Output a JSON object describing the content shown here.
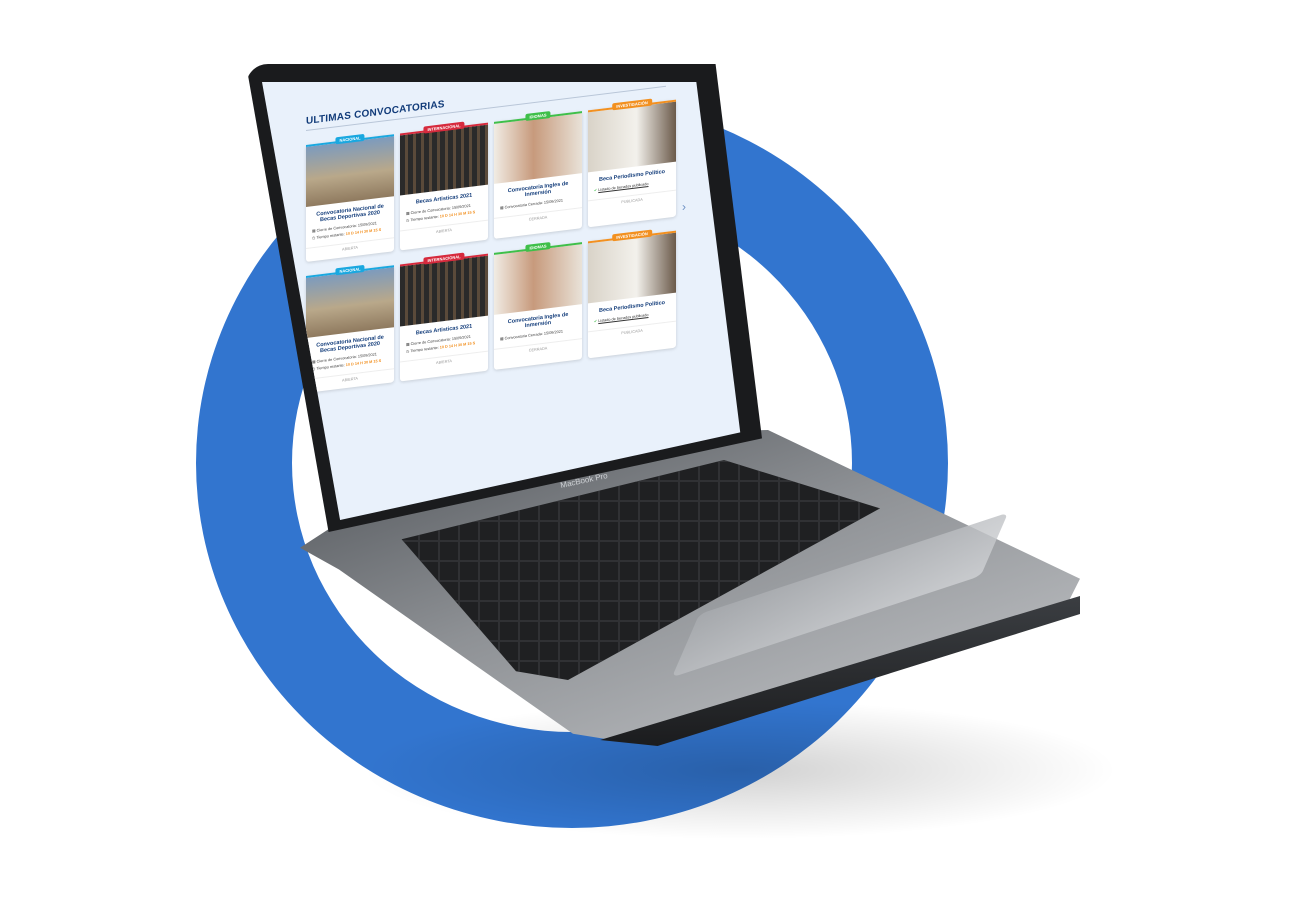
{
  "section_title": "ULTIMAS CONVOCATORIAS",
  "colors": {
    "accent_blue": "#3275cf",
    "nacional": "#1aa8e0",
    "internacional": "#d62a3d",
    "idiomas": "#3fbf4a",
    "investigacion": "#f29020"
  },
  "cards": [
    {
      "badge": "NACIONAL",
      "title": "Convocatoria Nacional de Becas Deportivas 2020",
      "close_label": "Cierre de Convocatoria:",
      "close_date": "15/09/2021",
      "remaining_label": "Tiempo restante:",
      "remaining_value": "10 D  14 H  30 M  15 S",
      "status": "ABIERTA"
    },
    {
      "badge": "INTERNACIONAL",
      "title": "Becas  Artisticas 2021",
      "close_label": "Cierre de Convocatoria:",
      "close_date": "15/09/2021",
      "remaining_label": "Tiempo restante:",
      "remaining_value": "10 D  14 H  30 M  15 S",
      "status": "ABIERTA"
    },
    {
      "badge": "IDIOMAS",
      "title": "Convocatoria Ingles de Inmersión",
      "close_label": "Convocatoria Cerrada:",
      "close_date": "15/09/2021",
      "status": "CERRADA"
    },
    {
      "badge": "INVESTIGACIÓN",
      "title": "Beca Periodismo Político",
      "link_label": "Listado de becados publicado",
      "status": "PUBLICADA"
    }
  ],
  "device_label": "MacBook Pro"
}
